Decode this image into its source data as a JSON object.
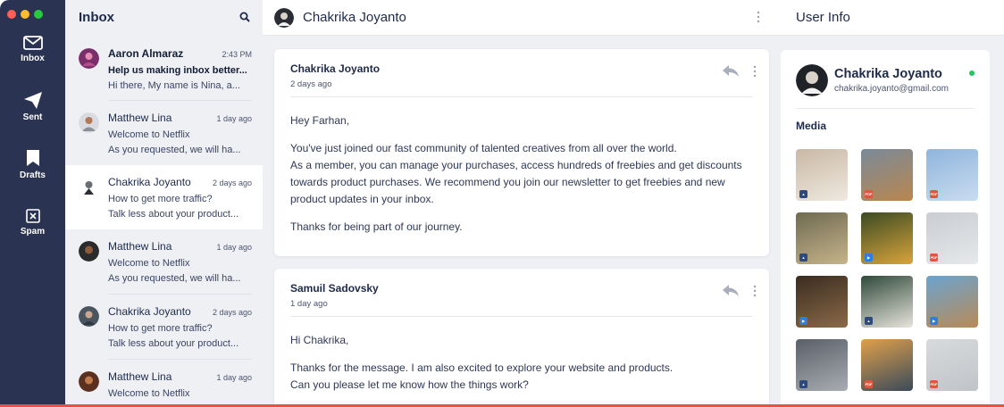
{
  "colors": {
    "rail_bg": "#2b3352",
    "list_bg": "#eef0f4",
    "text_dark": "#1e2a4a",
    "online": "#22c55e",
    "traffic_red": "#ff5f57",
    "traffic_yellow": "#febc2e",
    "traffic_green": "#28c840",
    "accent_yellow": "#f4b740",
    "accent_cyan": "#4fd3e8",
    "accent_red": "#e2553f"
  },
  "rail": {
    "items": [
      {
        "label": "Inbox",
        "icon": "envelope-icon"
      },
      {
        "label": "Sent",
        "icon": "paper-plane-icon"
      },
      {
        "label": "Drafts",
        "icon": "bookmark-icon"
      },
      {
        "label": "Spam",
        "icon": "spam-box-icon"
      }
    ]
  },
  "list": {
    "title": "Inbox",
    "search_icon": "search-icon",
    "messages": [
      {
        "name": "Aaron Almaraz",
        "time": "2:43 PM",
        "subject": "Help us making inbox better...",
        "preview": "Hi there, My name is Nina, a...",
        "unread": true
      },
      {
        "name": "Matthew Lina",
        "time": "1 day ago",
        "subject": "Welcome to Netflix",
        "preview": "As you requested, we will ha...",
        "unread": false
      },
      {
        "name": "Chakrika Joyanto",
        "time": "2 days ago",
        "subject": "How to get more traffic?",
        "preview": "Talk less about your product...",
        "unread": false,
        "active": true
      },
      {
        "name": "Matthew Lina",
        "time": "1 day ago",
        "subject": "Welcome to Netflix",
        "preview": "As you requested, we will ha...",
        "unread": false
      },
      {
        "name": "Chakrika Joyanto",
        "time": "2 days ago",
        "subject": "How to get more traffic?",
        "preview": "Talk less about your product...",
        "unread": false
      },
      {
        "name": "Matthew Lina",
        "time": "1 day ago",
        "subject": "Welcome to Netflix",
        "preview": "",
        "unread": false
      }
    ]
  },
  "thread": {
    "title": "Chakrika Joyanto",
    "emails": [
      {
        "sender": "Chakrika Joyanto",
        "when": "2 days ago",
        "greeting": "Hey Farhan,",
        "lines": [
          "You've just joined our fast community of talented creatives from all over the world.",
          "As a member, you can manage your purchases, access hundreds of freebies and get discounts",
          "towards product purchases. We recommend you join our newsletter to get freebies and new",
          "product updates in your inbox."
        ],
        "closing": "Thanks for being part of our journey."
      },
      {
        "sender": "Samuil Sadovsky",
        "when": "1 day ago",
        "greeting": "Hi Chakrika,",
        "lines": [
          "Thanks for the message. I am also excited to explore your website and products.",
          "Can you please let me know how the things work?"
        ],
        "closing": ""
      }
    ]
  },
  "info": {
    "title": "User Info",
    "name": "Chakrika Joyanto",
    "email": "chakrika.joyanto@gmail.com",
    "media_title": "Media",
    "media": [
      {
        "kind": "image",
        "tag": "image-icon",
        "colors": [
          "#c9b8a4",
          "#efe9e0"
        ]
      },
      {
        "kind": "pdf",
        "tag": "pdf-icon",
        "colors": [
          "#7a8a9a",
          "#b9864e"
        ]
      },
      {
        "kind": "pdf",
        "tag": "pdf-icon",
        "colors": [
          "#8fb5dd",
          "#c9dcef"
        ]
      },
      {
        "kind": "image",
        "tag": "image-icon",
        "colors": [
          "#6f6a52",
          "#c6b48a"
        ]
      },
      {
        "kind": "video",
        "tag": "video-icon",
        "colors": [
          "#3b4b24",
          "#d9a43b"
        ]
      },
      {
        "kind": "pdf",
        "tag": "pdf-icon",
        "colors": [
          "#c9cdd2",
          "#e6e8ea"
        ]
      },
      {
        "kind": "video",
        "tag": "video-icon",
        "colors": [
          "#3a2c20",
          "#8a6a48"
        ]
      },
      {
        "kind": "image",
        "tag": "image-icon",
        "colors": [
          "#2f4a3a",
          "#e8e4dc"
        ]
      },
      {
        "kind": "video",
        "tag": "video-icon",
        "colors": [
          "#6ba4cf",
          "#b88a58"
        ]
      },
      {
        "kind": "image",
        "tag": "image-icon",
        "colors": [
          "#5a6068",
          "#a8adb3"
        ]
      },
      {
        "kind": "pdf",
        "tag": "pdf-icon",
        "colors": [
          "#e0a04a",
          "#3a4a5a"
        ]
      },
      {
        "kind": "pdf",
        "tag": "pdf-icon",
        "colors": [
          "#d8dadc",
          "#c0c4c8"
        ]
      }
    ]
  }
}
